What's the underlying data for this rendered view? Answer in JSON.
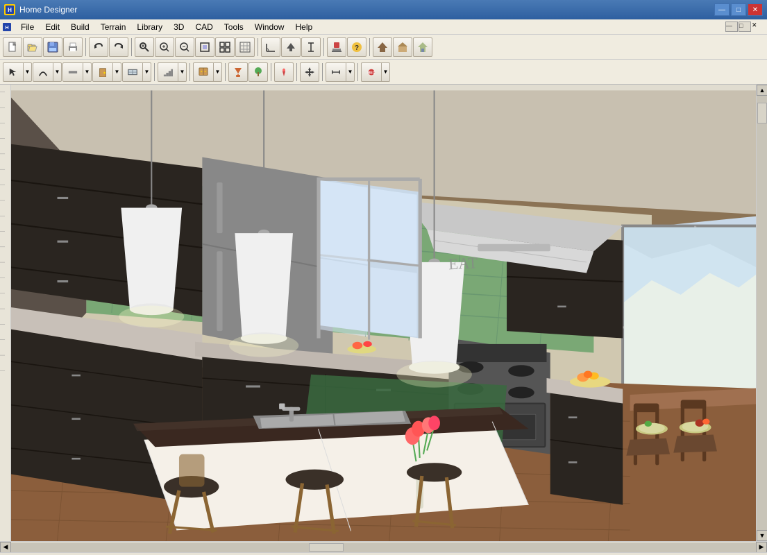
{
  "titleBar": {
    "title": "Home Designer",
    "icon": "HD",
    "controls": {
      "minimize": "—",
      "maximize": "□",
      "close": "✕"
    }
  },
  "menuBar": {
    "items": [
      "File",
      "Edit",
      "Build",
      "Terrain",
      "Library",
      "3D",
      "CAD",
      "Tools",
      "Window",
      "Help"
    ]
  },
  "toolbar1": {
    "buttons": [
      {
        "name": "new",
        "icon": "new-file-icon",
        "symbol": "📄"
      },
      {
        "name": "open",
        "icon": "open-file-icon",
        "symbol": "📂"
      },
      {
        "name": "save",
        "icon": "save-icon",
        "symbol": "💾"
      },
      {
        "name": "print",
        "icon": "print-icon",
        "symbol": "🖨"
      },
      {
        "name": "undo",
        "icon": "undo-icon",
        "symbol": "↩"
      },
      {
        "name": "redo",
        "icon": "redo-icon",
        "symbol": "↪"
      },
      {
        "name": "zoom-in-glass",
        "icon": "zoom-magnifier-icon",
        "symbol": "🔍"
      },
      {
        "name": "zoom-in",
        "icon": "zoom-in-icon",
        "symbol": "⊕"
      },
      {
        "name": "zoom-out",
        "icon": "zoom-out-icon",
        "symbol": "⊖"
      },
      {
        "name": "fit-window",
        "icon": "fit-window-icon",
        "symbol": "⊡"
      },
      {
        "name": "fit-all",
        "icon": "fit-all-icon",
        "symbol": "⊞"
      },
      {
        "name": "toggle-snap",
        "icon": "snap-icon",
        "symbol": "⊟"
      },
      {
        "name": "angle",
        "icon": "angle-icon",
        "symbol": "∠"
      },
      {
        "name": "arrow-up",
        "icon": "arrow-up-icon",
        "symbol": "▲"
      },
      {
        "name": "measure",
        "icon": "measure-icon",
        "symbol": "↕"
      },
      {
        "name": "stamp",
        "icon": "stamp-icon",
        "symbol": "⚑"
      },
      {
        "name": "help",
        "icon": "help-icon",
        "symbol": "?"
      },
      {
        "name": "roof1",
        "icon": "roof1-icon",
        "symbol": "⌂"
      },
      {
        "name": "roof2",
        "icon": "roof2-icon",
        "symbol": "⌂"
      },
      {
        "name": "house",
        "icon": "house-icon",
        "symbol": "🏠"
      }
    ]
  },
  "toolbar2": {
    "buttons": [
      {
        "name": "select",
        "icon": "cursor-icon",
        "symbol": "↖"
      },
      {
        "name": "arc",
        "icon": "arc-icon",
        "symbol": "⌒"
      },
      {
        "name": "wall",
        "icon": "wall-icon",
        "symbol": "═"
      },
      {
        "name": "door",
        "icon": "door-icon",
        "symbol": "▭"
      },
      {
        "name": "window-tool",
        "icon": "window-tool-icon",
        "symbol": "⊞"
      },
      {
        "name": "stair",
        "icon": "stair-icon",
        "symbol": "⊿"
      },
      {
        "name": "cabinet",
        "icon": "cabinet-icon",
        "symbol": "▬"
      },
      {
        "name": "paint",
        "icon": "paint-icon",
        "symbol": "🖌"
      },
      {
        "name": "landscape",
        "icon": "landscape-icon",
        "symbol": "🌿"
      },
      {
        "name": "pin",
        "icon": "pin-icon",
        "symbol": "📍"
      },
      {
        "name": "move",
        "icon": "move-icon",
        "symbol": "✥"
      },
      {
        "name": "dimension-up",
        "icon": "dimension-up-icon",
        "symbol": "↑"
      },
      {
        "name": "dimension-tool",
        "icon": "dimension-tool-icon",
        "symbol": "⇔"
      },
      {
        "name": "record",
        "icon": "record-icon",
        "symbol": "⏺"
      }
    ]
  },
  "viewport": {
    "type": "3D Kitchen Render",
    "description": "3D perspective view of a kitchen with dark cabinets, green subway tile, hardwood floors, and kitchen island"
  },
  "statusBar": {
    "text": ""
  },
  "colors": {
    "titleBarGradientStart": "#4a7ab5",
    "titleBarGradientEnd": "#2d5fa0",
    "toolbarBg": "#f0ece0",
    "accent": "#316ac5"
  }
}
